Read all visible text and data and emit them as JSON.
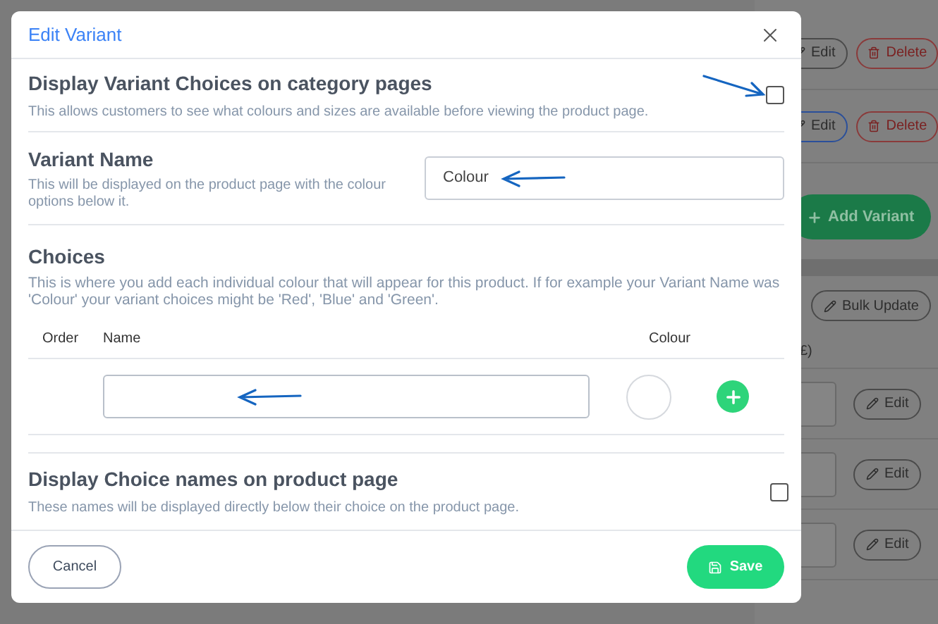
{
  "background_page": {
    "rows": [
      {
        "edit_label": "Edit",
        "delete_label": "Delete",
        "focused": false
      },
      {
        "edit_label": "Edit",
        "delete_label": "Delete",
        "focused": true
      }
    ],
    "add_variant_label": "Add Variant",
    "bulk_update_label": "Bulk Update",
    "column_heading": "£)",
    "price_rows": [
      {
        "edit_label": "Edit"
      },
      {
        "edit_label": "Edit"
      },
      {
        "edit_label": "Edit"
      }
    ]
  },
  "dialog": {
    "title": "Edit Variant",
    "display_variant_choices": {
      "title": "Display Variant Choices on category pages",
      "description": "This allows customers to see what colours and sizes are available before viewing the product page.",
      "checked": false
    },
    "variant_name": {
      "title": "Variant Name",
      "description": "This will be displayed on the product page with the colour options below it.",
      "value": "Colour"
    },
    "choices": {
      "title": "Choices",
      "description": "This is where you add each individual colour that will appear for this product. If for example your Variant Name was 'Colour' your variant choices might be 'Red', 'Blue' and 'Green'.",
      "columns": [
        "Order",
        "Name",
        "Colour"
      ]
    },
    "display_choice_names": {
      "title": "Display Choice names on product page",
      "description": "These names will be displayed directly below their choice on the product page.",
      "checked": false
    },
    "cancel_label": "Cancel",
    "save_label": "Save"
  }
}
